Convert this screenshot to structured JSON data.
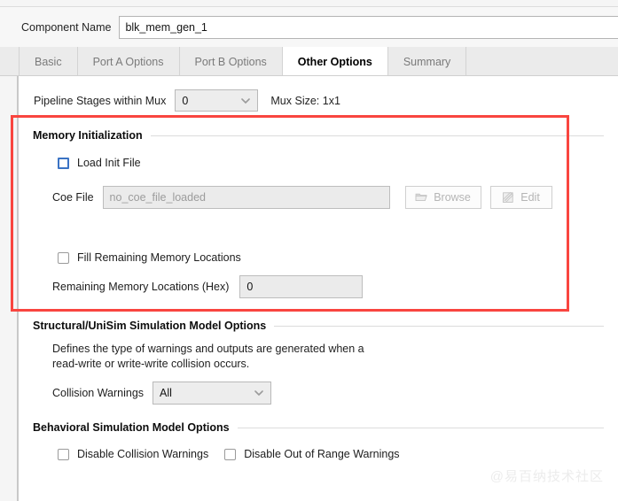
{
  "component": {
    "label": "Component Name",
    "value": "blk_mem_gen_1"
  },
  "tabs": [
    {
      "label": "Basic",
      "active": false
    },
    {
      "label": "Port A Options",
      "active": false
    },
    {
      "label": "Port B Options",
      "active": false
    },
    {
      "label": "Other Options",
      "active": true
    },
    {
      "label": "Summary",
      "active": false
    }
  ],
  "pipeline": {
    "label": "Pipeline Stages within Mux",
    "value": "0",
    "caret_icon": "chevron-down-icon",
    "mux_size": "Mux Size: 1x1"
  },
  "memory_init": {
    "title": "Memory Initialization",
    "load_init_file": {
      "label": "Load Init File",
      "checked": false
    },
    "coe_file": {
      "label": "Coe File",
      "placeholder": "no_coe_file_loaded",
      "value": ""
    },
    "browse_button": {
      "label": "Browse",
      "icon": "folder-open-icon",
      "disabled": true
    },
    "edit_button": {
      "label": "Edit",
      "icon": "pencil-note-icon",
      "disabled": true
    },
    "fill_remaining": {
      "label": "Fill Remaining Memory Locations",
      "checked": false
    },
    "remaining_hex": {
      "label": "Remaining Memory Locations (Hex)",
      "value": "0"
    }
  },
  "structural": {
    "title": "Structural/UniSim Simulation Model Options",
    "description_line1": "Defines the type of warnings and outputs are generated when a",
    "description_line2": "read-write or write-write collision occurs.",
    "collision_warnings": {
      "label": "Collision Warnings",
      "value": "All",
      "caret_icon": "chevron-down-icon"
    }
  },
  "behavioral": {
    "title": "Behavioral Simulation Model Options",
    "disable_collision": {
      "label": "Disable Collision Warnings",
      "checked": false
    },
    "disable_out_of_range": {
      "label": "Disable Out of Range Warnings",
      "checked": false
    }
  },
  "highlight": {
    "color": "#f9453f"
  },
  "watermark": {
    "text": "@易百纳技术社区"
  }
}
